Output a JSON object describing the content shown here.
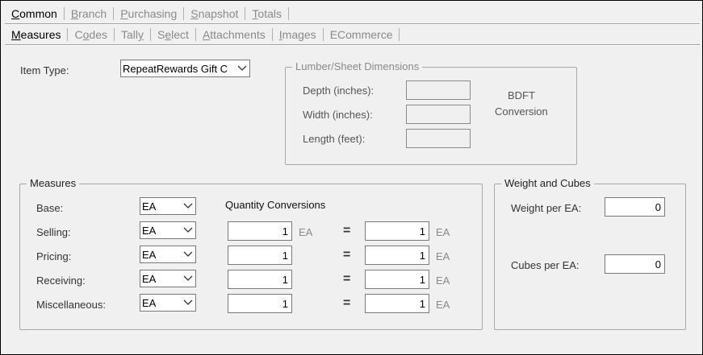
{
  "tabs_primary": [
    {
      "label": "Common",
      "mnemonic": "C",
      "rest": "ommon",
      "active": true
    },
    {
      "label": "Branch",
      "mnemonic": "B",
      "rest": "ranch",
      "active": false
    },
    {
      "label": "Purchasing",
      "mnemonic": "P",
      "rest": "urchasing",
      "active": false
    },
    {
      "label": "Snapshot",
      "mnemonic": "S",
      "rest": "napshot",
      "active": false
    },
    {
      "label": "Totals",
      "mnemonic": "T",
      "rest": "otals",
      "active": false
    }
  ],
  "tabs_secondary": [
    {
      "pre": "",
      "mnemonic": "M",
      "rest": "easures",
      "active": true
    },
    {
      "pre": "C",
      "mnemonic": "o",
      "rest": "des",
      "active": false
    },
    {
      "pre": "Tall",
      "mnemonic": "y",
      "rest": "",
      "active": false
    },
    {
      "pre": "S",
      "mnemonic": "e",
      "rest": "lect",
      "active": false
    },
    {
      "pre": "",
      "mnemonic": "A",
      "rest": "ttachments",
      "active": false
    },
    {
      "pre": "",
      "mnemonic": "I",
      "rest": "mages",
      "active": false
    },
    {
      "pre": "ECommerce",
      "mnemonic": "",
      "rest": "",
      "active": false
    }
  ],
  "item_type": {
    "label": "Item Type:",
    "value": "RepeatRewards Gift C"
  },
  "lumber": {
    "title": "Lumber/Sheet Dimensions",
    "depth_label": "Depth (inches):",
    "width_label": "Width (inches):",
    "length_label": "Length (feet):",
    "bdft_line1": "BDFT",
    "bdft_line2": "Conversion"
  },
  "measures": {
    "title": "Measures",
    "quantity_conversions": "Quantity Conversions",
    "rows": [
      {
        "label": "Base:",
        "unit": "EA"
      },
      {
        "label": "Selling:",
        "unit": "EA",
        "left": "1",
        "left_unit": "EA",
        "eq": "=",
        "right": "1",
        "right_unit": "EA"
      },
      {
        "label": "Pricing:",
        "unit": "EA",
        "left": "1",
        "eq": "=",
        "right": "1",
        "right_unit": "EA"
      },
      {
        "label": "Receiving:",
        "unit": "EA",
        "left": "1",
        "eq": "=",
        "right": "1",
        "right_unit": "EA"
      },
      {
        "label": "Miscellaneous:",
        "unit": "EA",
        "left": "1",
        "eq": "=",
        "right": "1",
        "right_unit": "EA"
      }
    ]
  },
  "weight_cubes": {
    "title": "Weight and Cubes",
    "weight_label": "Weight per EA:",
    "weight_value": "0",
    "cubes_label": "Cubes per EA:",
    "cubes_value": "0"
  }
}
